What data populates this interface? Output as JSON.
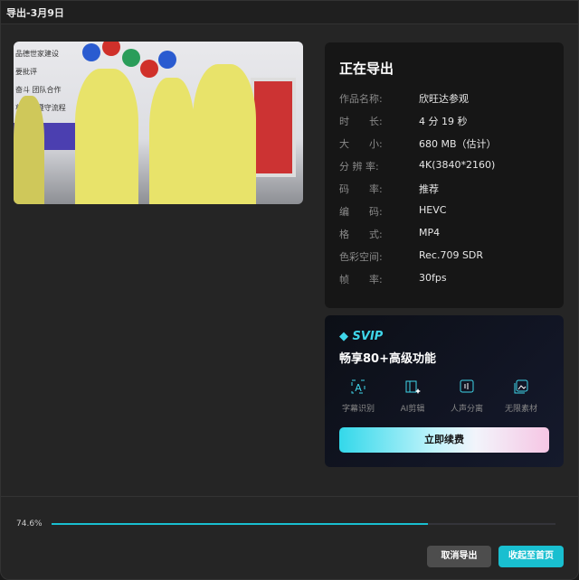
{
  "window": {
    "title": "导出-3月9日"
  },
  "preview": {
    "wall_text": [
      "品德世家建设",
      "要批评",
      "奋斗 团队合作",
      "尊重 / 遵守流程"
    ]
  },
  "export_info": {
    "heading": "正在导出",
    "rows": [
      {
        "label": "作品名称:",
        "value": "欣旺达参观"
      },
      {
        "label": "时　　长:",
        "value": "4 分 19 秒"
      },
      {
        "label": "大　　小:",
        "value": "680 MB（估计）"
      },
      {
        "label": "分 辨 率:",
        "value": "4K(3840*2160)"
      },
      {
        "label": "码　　率:",
        "value": "推荐"
      },
      {
        "label": "编　　码:",
        "value": "HEVC"
      },
      {
        "label": "格　　式:",
        "value": "MP4"
      },
      {
        "label": "色彩空间:",
        "value": "Rec.709 SDR"
      },
      {
        "label": "帧　　率:",
        "value": "30fps"
      }
    ]
  },
  "vip": {
    "badge": "SVIP",
    "headline": "畅享80+高级功能",
    "features": [
      {
        "label": "字幕识别",
        "icon": "subtitle-recognition-icon"
      },
      {
        "label": "AI剪辑",
        "icon": "ai-edit-icon"
      },
      {
        "label": "人声分离",
        "icon": "voice-separation-icon"
      },
      {
        "label": "无限素材",
        "icon": "unlimited-assets-icon"
      }
    ],
    "renew_label": "立即续费",
    "accent": "#3fd6ea"
  },
  "progress": {
    "percent_label": "74.6%",
    "value": 74.6,
    "color": "#19bfd0"
  },
  "buttons": {
    "cancel": "取消导出",
    "collapse": "收起至首页"
  }
}
